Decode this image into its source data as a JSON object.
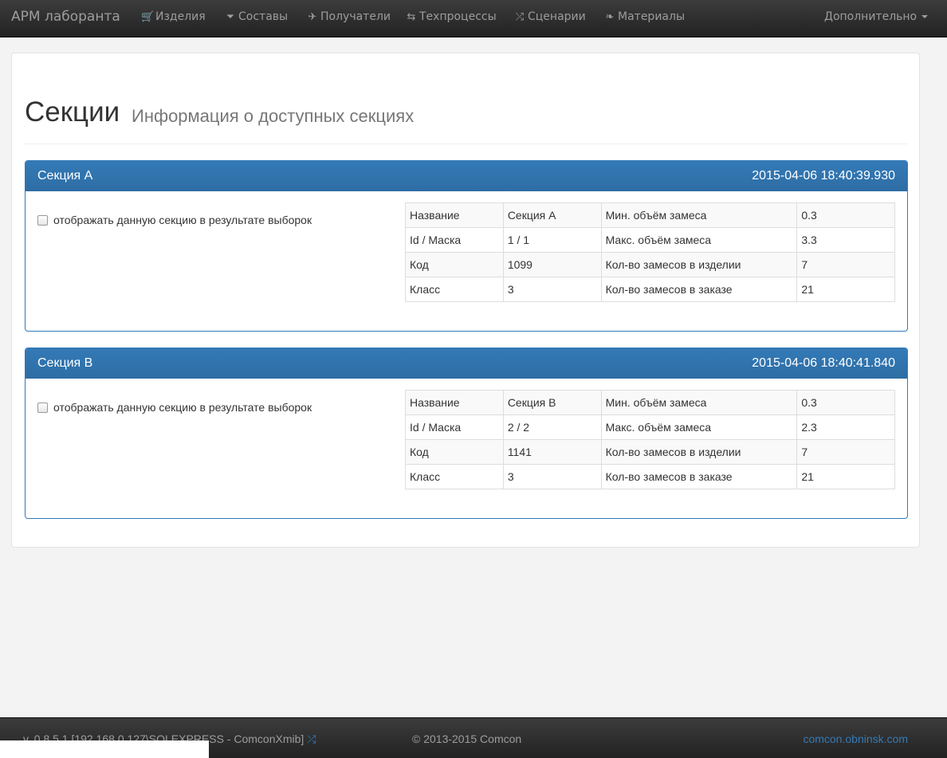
{
  "navbar": {
    "brand": "АРМ лаборанта",
    "items": [
      {
        "label": "Изделия",
        "icon": "cart-icon",
        "glyph": "🛒"
      },
      {
        "label": "Составы",
        "icon": "filter-icon",
        "glyph": "⏷"
      },
      {
        "label": "Получатели",
        "icon": "plane-icon",
        "glyph": "✈"
      },
      {
        "label": "Техпроцессы",
        "icon": "retweet-icon",
        "glyph": "⇆"
      },
      {
        "label": "Сценарии",
        "icon": "random-icon",
        "glyph": "⤮"
      },
      {
        "label": "Материалы",
        "icon": "leaf-icon",
        "glyph": "❧"
      }
    ],
    "more": "Дополнительно"
  },
  "page": {
    "title": "Секции",
    "subtitle": "Информация о доступных секциях"
  },
  "sections": [
    {
      "title": "Секция A",
      "timestamp": "2015-04-06 18:40:39.930",
      "checkbox_label": "отображать данную секцию в результате выборок",
      "checked": false,
      "rows": [
        [
          "Название",
          "Секция A",
          "Мин. объём замеса",
          "0.3"
        ],
        [
          "Id / Маска",
          "1 / 1",
          "Макс. объём замеса",
          "3.3"
        ],
        [
          "Код",
          "1099",
          "Кол-во замесов в изделии",
          "7"
        ],
        [
          "Класс",
          "3",
          "Кол-во замесов в заказе",
          "21"
        ]
      ]
    },
    {
      "title": "Секция B",
      "timestamp": "2015-04-06 18:40:41.840",
      "checkbox_label": "отображать данную секцию в результате выборок",
      "checked": false,
      "rows": [
        [
          "Название",
          "Секция B",
          "Мин. объём замеса",
          "0.3"
        ],
        [
          "Id / Маска",
          "2 / 2",
          "Макс. объём замеса",
          "2.3"
        ],
        [
          "Код",
          "1141",
          "Кол-во замесов в изделии",
          "7"
        ],
        [
          "Класс",
          "3",
          "Кол-во замесов в заказе",
          "21"
        ]
      ]
    }
  ],
  "footer": {
    "version": "v. 0.8.5.1 [192.168.0.127\\SQLEXPRESS - ComconXmib]",
    "version_icon": "random-icon",
    "copyright": "© 2013-2015 Comcon",
    "link": "comcon.obninsk.com"
  },
  "colors": {
    "primary": "#337ab7",
    "navbar": "#222222",
    "nav_text": "#9d9d9d"
  }
}
